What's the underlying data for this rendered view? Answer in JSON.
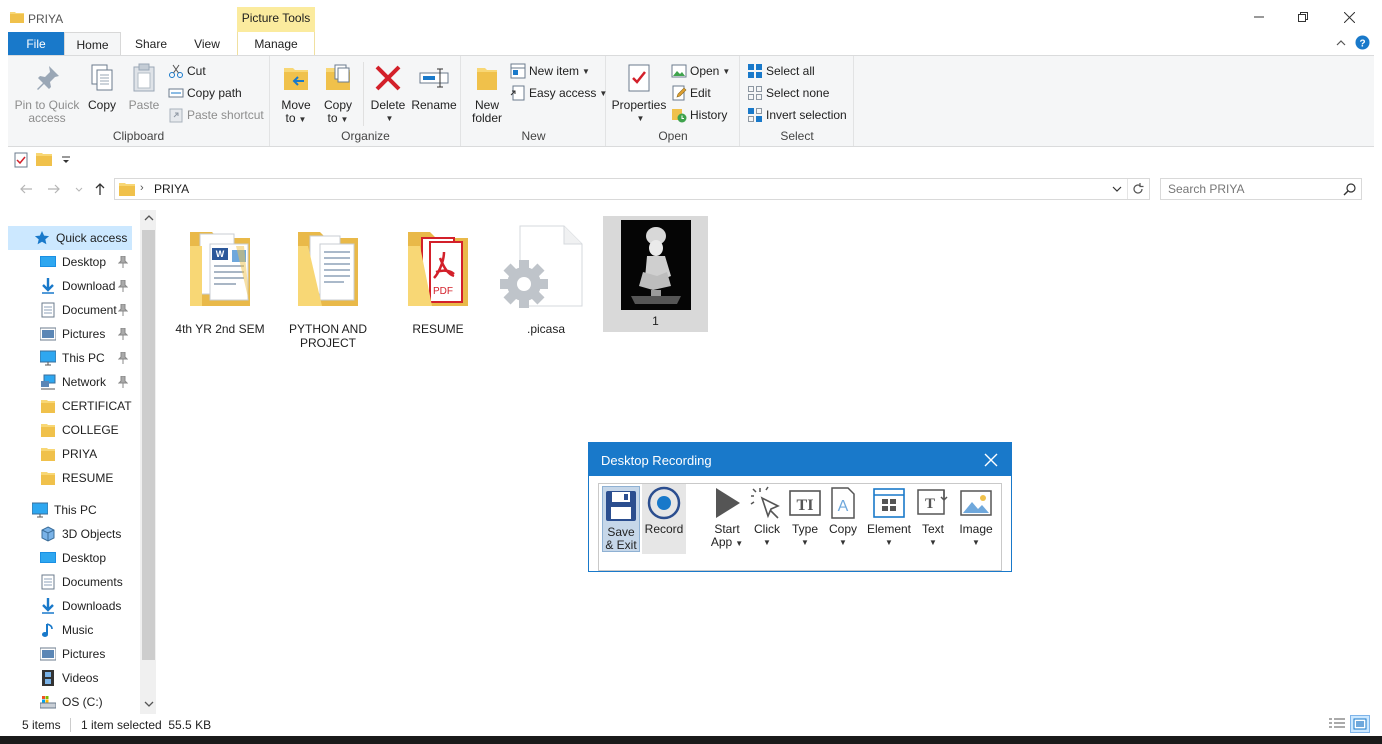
{
  "window": {
    "title": "PRIYA",
    "context_tab_title": "Picture Tools"
  },
  "tabs": {
    "file": "File",
    "home": "Home",
    "share": "Share",
    "view": "View",
    "manage": "Manage"
  },
  "ribbon": {
    "clipboard": {
      "label": "Clipboard",
      "pin_line1": "Pin to Quick",
      "pin_line2": "access",
      "copy": "Copy",
      "paste": "Paste",
      "cut": "Cut",
      "copy_path": "Copy path",
      "paste_shortcut": "Paste shortcut"
    },
    "organize": {
      "label": "Organize",
      "move_to_line1": "Move",
      "move_to_line2": "to",
      "copy_to_line1": "Copy",
      "copy_to_line2": "to",
      "delete": "Delete",
      "rename": "Rename"
    },
    "new": {
      "label": "New",
      "new_folder_line1": "New",
      "new_folder_line2": "folder",
      "new_item": "New item",
      "easy_access": "Easy access"
    },
    "open": {
      "label": "Open",
      "properties": "Properties",
      "open": "Open",
      "edit": "Edit",
      "history": "History"
    },
    "select": {
      "label": "Select",
      "select_all": "Select all",
      "select_none": "Select none",
      "invert_selection": "Invert selection"
    }
  },
  "address": {
    "path": "PRIYA",
    "search_placeholder": "Search PRIYA"
  },
  "nav": {
    "quick_access": "Quick access",
    "items": [
      {
        "label": "Desktop",
        "pinned": true
      },
      {
        "label": "Download",
        "pinned": true
      },
      {
        "label": "Document",
        "pinned": true
      },
      {
        "label": "Pictures",
        "pinned": true
      },
      {
        "label": "This PC",
        "pinned": true
      },
      {
        "label": "Network",
        "pinned": true
      },
      {
        "label": "CERTIFICATES",
        "pinned": false
      },
      {
        "label": "COLLEGE",
        "pinned": false
      },
      {
        "label": "PRIYA",
        "pinned": false
      },
      {
        "label": "RESUME",
        "pinned": false
      }
    ],
    "this_pc": "This PC",
    "pc_items": [
      "3D Objects",
      "Desktop",
      "Documents",
      "Downloads",
      "Music",
      "Pictures",
      "Videos",
      "OS (C:)"
    ]
  },
  "files": [
    {
      "name": "4th YR 2nd SEM",
      "kind": "folder-word"
    },
    {
      "name": "PYTHON AND PROJECT",
      "kind": "folder-docs"
    },
    {
      "name": "RESUME",
      "kind": "folder-pdf"
    },
    {
      "name": ".picasa",
      "kind": "settings-file"
    },
    {
      "name": "1",
      "kind": "image",
      "selected": true
    }
  ],
  "status": {
    "items_count": "5 items",
    "selection": "1 item selected  55.5 KB"
  },
  "recorder": {
    "title": "Desktop Recording",
    "save_line1": "Save",
    "save_line2": "& Exit",
    "record": "Record",
    "start_app_line1": "Start",
    "start_app_line2": "App",
    "click": "Click",
    "type": "Type",
    "copy": "Copy",
    "element": "Element",
    "text": "Text",
    "image": "Image"
  },
  "colors": {
    "accent": "#1979ca",
    "folder": "#f8d775",
    "context_tab": "#fbeb9e",
    "delete_red": "#d3202a"
  }
}
